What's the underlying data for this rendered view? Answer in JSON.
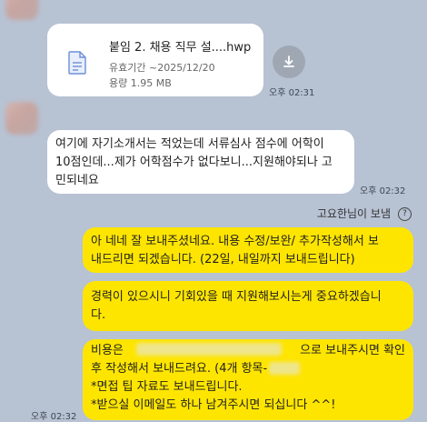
{
  "file_message": {
    "file_name": "붙임 2. 채용 직무 설....hwp",
    "expiry": "유효기간 ~2025/12/20",
    "size": "용량 1.95 MB",
    "time": "오후 02:31",
    "icon": "document-icon",
    "download_icon": "download-icon"
  },
  "text_message": {
    "text": "여기에 자기소개서는 적었는데 서류심사 점수에 어학이\n10점인데...제가 어학점수가 없다보니...지원해야되나 고\n민되네요",
    "time": "오후 02:32"
  },
  "read_notice": {
    "label": "고요한님이 보냄",
    "icon": "question-icon",
    "icon_glyph": "?"
  },
  "replies": [
    {
      "text": "아 네네 잘 보내주셨네요. 내용 수정/보완/ 추가작성해서 보\n내드리면 되겠습니다. (22일, 내일까지 보내드립니다)"
    },
    {
      "text": "경력이 있으시니 기회있을 때 지원해보시는게 중요하겠습니\n다."
    },
    {
      "text": "비용은                                               으로 보내주시면 확인\n후 작성해서 보내드려요. (4개 항목-\n*면접 팁 자료도 보내드립니다.\n*받으실 이메일도 하나 남겨주시면 되십니다 ^^!"
    }
  ],
  "last_time": "오후 02:32",
  "colors": {
    "background": "#b7c2d3",
    "outgoing_bubble": "#fee500",
    "incoming_bubble": "#ffffff"
  }
}
